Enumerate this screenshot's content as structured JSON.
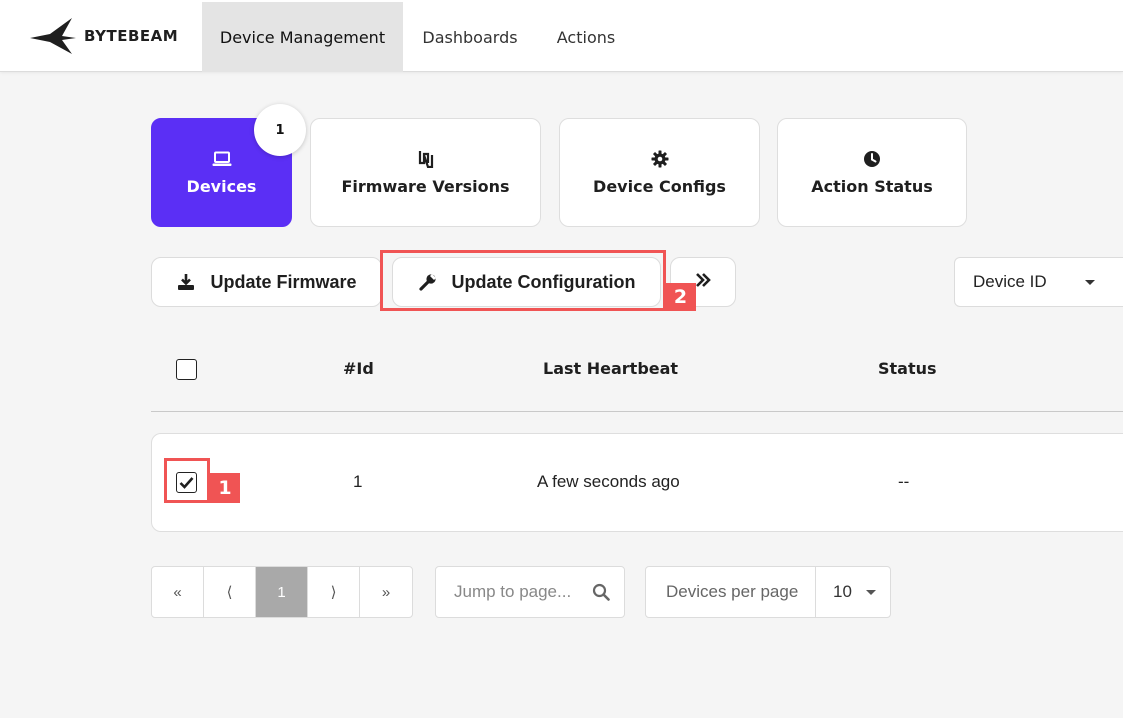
{
  "header": {
    "brand": "BYTEBEAM",
    "nav": [
      {
        "label": "Device Management",
        "active": true
      },
      {
        "label": "Dashboards",
        "active": false
      },
      {
        "label": "Actions",
        "active": false
      }
    ]
  },
  "cards": [
    {
      "label": "Devices",
      "icon": "laptop-icon",
      "active": true,
      "badge": "1"
    },
    {
      "label": "Firmware Versions",
      "icon": "firmware-icon",
      "active": false
    },
    {
      "label": "Device Configs",
      "icon": "gear-icon",
      "active": false
    },
    {
      "label": "Action Status",
      "icon": "clock-icon",
      "active": false
    }
  ],
  "actions": {
    "update_firmware": "Update Firmware",
    "update_configuration": "Update Configuration",
    "more": "»",
    "filter_dropdown": "Device ID"
  },
  "annotations": {
    "step_1": "1",
    "step_2": "2"
  },
  "table": {
    "headers": {
      "id": "#Id",
      "heartbeat": "Last Heartbeat",
      "status": "Status"
    },
    "rows": [
      {
        "checked": true,
        "id": "1",
        "heartbeat": "A few seconds ago",
        "status": "--"
      }
    ]
  },
  "pagination": {
    "first": "«",
    "prev": "⟨",
    "current": "1",
    "next": "⟩",
    "last": "»",
    "jump_placeholder": "Jump to page...",
    "per_page_label": "Devices per page",
    "per_page_value": "10"
  },
  "colors": {
    "accent": "#5b2ff5",
    "highlight": "#f05454"
  }
}
